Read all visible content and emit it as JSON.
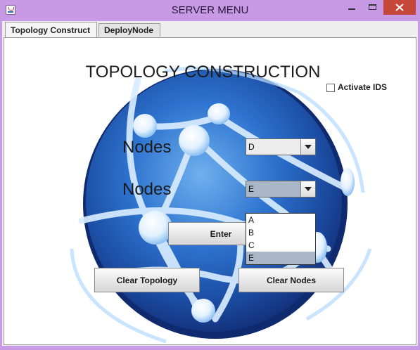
{
  "window": {
    "title": "SERVER MENU"
  },
  "tabs": [
    {
      "label": "Topology Construct",
      "active": true
    },
    {
      "label": "DeployNode",
      "active": false
    }
  ],
  "panel": {
    "heading": "TOPOLOGY CONSTRUCTION",
    "activate_ids_label": "Activate IDS",
    "activate_ids_checked": false,
    "nodes_label_1": "Nodes",
    "nodes_label_2": "Nodes",
    "combo1": {
      "value": "D"
    },
    "combo2": {
      "value": "E",
      "open": true,
      "options": [
        "A",
        "B",
        "C",
        "E"
      ],
      "selected": "E"
    },
    "enter_button": "Enter",
    "clear_topology_button": "Clear Topology",
    "clear_nodes_button": "Clear Nodes"
  },
  "colors": {
    "titlebar": "#c89ae6",
    "close_button": "#c7463a",
    "globe_dark": "#1a3f8c",
    "globe_light": "#8fc1f0",
    "dropdown_selection": "#a9b7c9"
  }
}
